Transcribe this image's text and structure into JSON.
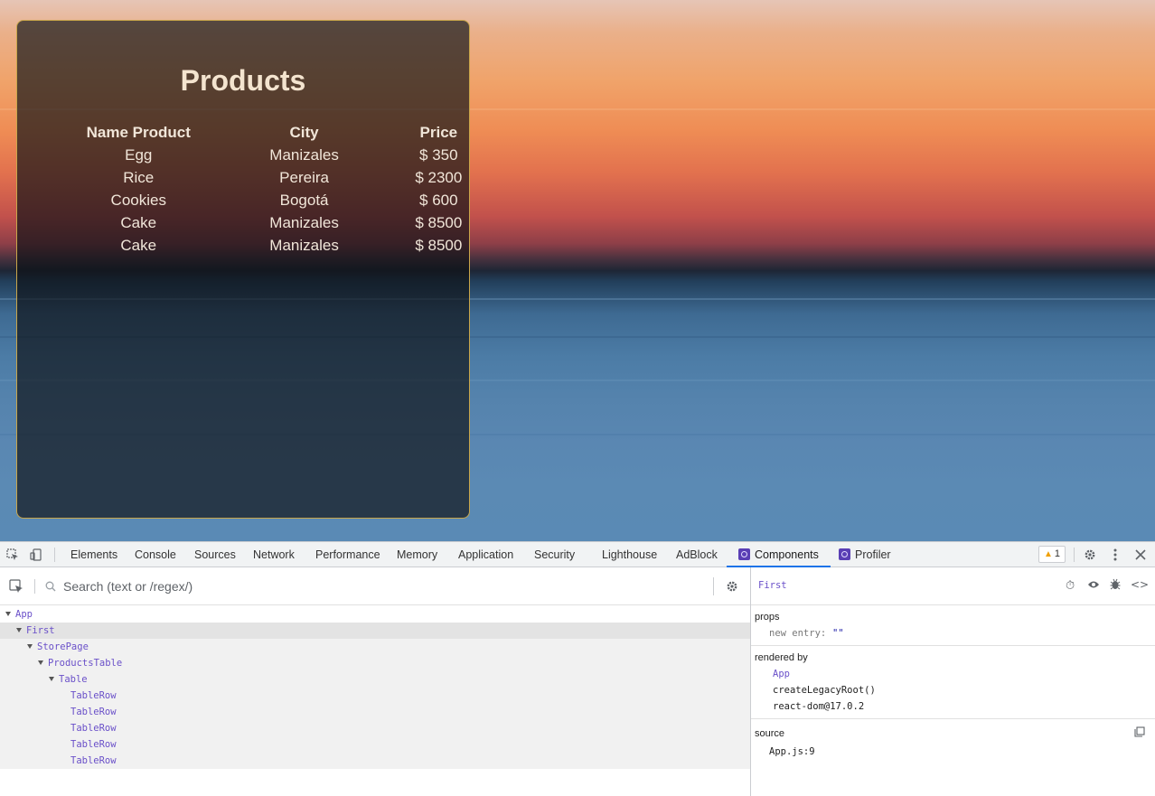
{
  "page": {
    "title": "Products",
    "columns": [
      "Name Product",
      "City",
      "Price"
    ],
    "rows": [
      [
        "Egg",
        "Manizales",
        "$ 350"
      ],
      [
        "Rice",
        "Pereira",
        "$ 2300"
      ],
      [
        "Cookies",
        "Bogotá",
        "$ 600"
      ],
      [
        "Cake",
        "Manizales",
        "$ 8500"
      ],
      [
        "Cake",
        "Manizales",
        "$ 8500"
      ]
    ]
  },
  "devtools": {
    "tabs": [
      "Elements",
      "Console",
      "Sources",
      "Network",
      "Performance",
      "Memory",
      "Application",
      "Security",
      "Lighthouse",
      "AdBlock",
      "Components",
      "Profiler"
    ],
    "active_tab": "Components",
    "warning_count": "1",
    "search_placeholder": "Search (text or /regex/)",
    "tree": [
      {
        "label": "App",
        "depth": 0,
        "expanded": true
      },
      {
        "label": "First",
        "depth": 1,
        "expanded": true,
        "selected": true
      },
      {
        "label": "StorePage",
        "depth": 2,
        "expanded": true
      },
      {
        "label": "ProductsTable",
        "depth": 3,
        "expanded": true
      },
      {
        "label": "Table",
        "depth": 4,
        "expanded": true
      },
      {
        "label": "TableRow",
        "depth": 5
      },
      {
        "label": "TableRow",
        "depth": 5
      },
      {
        "label": "TableRow",
        "depth": 5
      },
      {
        "label": "TableRow",
        "depth": 5
      },
      {
        "label": "TableRow",
        "depth": 5
      }
    ],
    "inspector": {
      "selected_name": "First",
      "props_title": "props",
      "prop_key": "new entry:",
      "prop_value": "\"\"",
      "rendered_by_title": "rendered by",
      "rendered_by": [
        "App",
        "createLegacyRoot()",
        "react-dom@17.0.2"
      ],
      "source_title": "source",
      "source_value": "App.js:9"
    }
  },
  "colors": {
    "accent": "#1a73e8",
    "component_name": "#6a50c9",
    "card_border": "#c9a64a"
  }
}
